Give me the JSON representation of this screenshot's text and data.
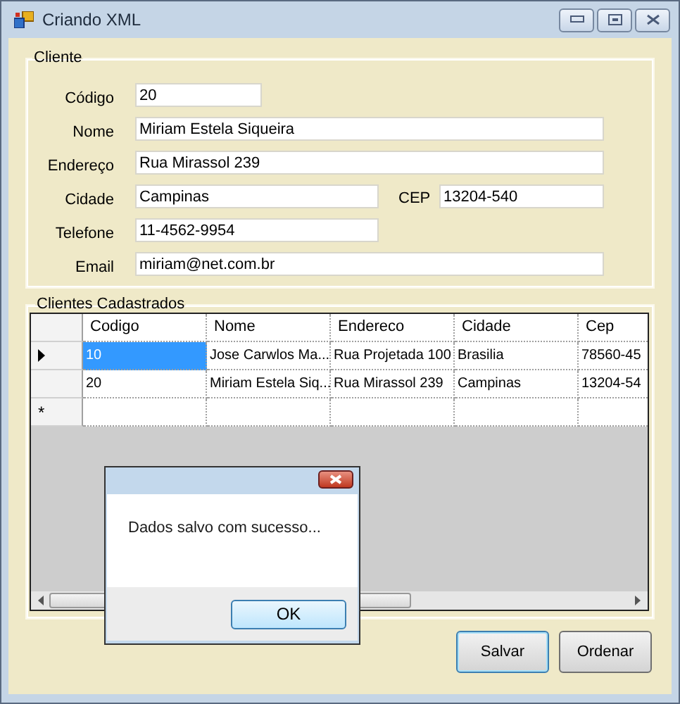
{
  "window": {
    "title": "Criando XML"
  },
  "cliente": {
    "title": "Cliente",
    "fields": [
      {
        "label": "Código",
        "value": "20"
      },
      {
        "label": "Nome",
        "value": "Miriam Estela Siqueira"
      },
      {
        "label": "Endereço",
        "value": "Rua Mirassol 239"
      },
      {
        "label": "Cidade",
        "value": "Campinas",
        "side": {
          "label": "CEP",
          "value": "13204-540"
        }
      },
      {
        "label": "Telefone",
        "value": "11-4562-9954"
      },
      {
        "label": "Email",
        "value": "miriam@net.com.br"
      }
    ]
  },
  "clientes_cadastrados": {
    "title": "Clientes Cadastrados",
    "columns": [
      "Codigo",
      "Nome",
      "Endereco",
      "Cidade",
      "Cep"
    ],
    "rows": [
      {
        "selected": true,
        "cells": [
          "10",
          "Jose Carwlos Ma...",
          "Rua Projetada 100",
          "Brasilia",
          "78560-45"
        ]
      },
      {
        "selected": false,
        "cells": [
          "20",
          "Miriam Estela Siq...",
          "Rua Mirassol 239",
          "Campinas",
          "13204-54"
        ]
      }
    ],
    "new_row_marker": "*"
  },
  "dialog": {
    "message": "Dados salvo com sucesso...",
    "button": "OK"
  },
  "buttons": [
    {
      "label": "Salvar",
      "focused": true
    },
    {
      "label": "Ordenar",
      "focused": false
    }
  ]
}
